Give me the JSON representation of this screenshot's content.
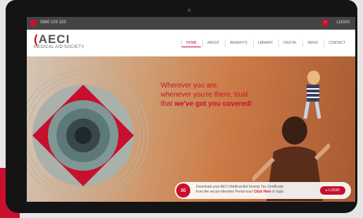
{
  "topbar": {
    "phone": "0860 103 103",
    "login": "LOGIN"
  },
  "brand": {
    "name": "AECI",
    "subtitle": "MEDICAL AID SOCIETY"
  },
  "nav": [
    "HOME",
    "ABOUT",
    "BENEFITS",
    "LIBRARY",
    "DIGITAL",
    "NEWS",
    "CONTACT"
  ],
  "hero": {
    "line1": "Wherever you are,",
    "line2": "whenever you're there, trust",
    "line3_prefix": "that ",
    "line3_bold": "we've got you covered!"
  },
  "cert": {
    "line1": "Download your AECI Medical Aid Society Tax Certificate",
    "line2_prefix": "from the secure Member Portal now! ",
    "link": "Click Here",
    "line2_suffix": " to login.",
    "button": "LOGIN"
  },
  "colors": {
    "accent": "#c8102e"
  },
  "icons": {
    "phone": "phone-icon",
    "login": "login-icon",
    "certificate": "certificate-icon"
  }
}
